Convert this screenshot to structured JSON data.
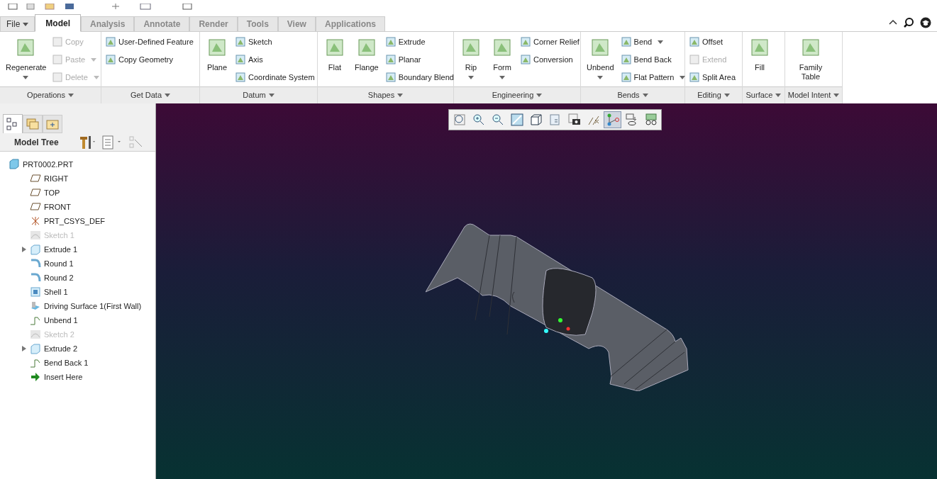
{
  "file_menu": {
    "label": "File"
  },
  "tabs": [
    {
      "label": "Model",
      "selected": true
    },
    {
      "label": "Analysis",
      "selected": false
    },
    {
      "label": "Annotate",
      "selected": false
    },
    {
      "label": "Render",
      "selected": false
    },
    {
      "label": "Tools",
      "selected": false
    },
    {
      "label": "View",
      "selected": false
    },
    {
      "label": "Applications",
      "selected": false
    }
  ],
  "ribbon_groups": [
    {
      "title": "Operations",
      "items": [
        {
          "kind": "large",
          "label": "Regenerate",
          "dropdown": true,
          "disabled": false
        },
        {
          "kind": "small",
          "label": "Copy",
          "dropdown": false,
          "disabled": true
        },
        {
          "kind": "small",
          "label": "Paste",
          "dropdown": true,
          "disabled": true
        },
        {
          "kind": "small",
          "label": "Delete",
          "dropdown": true,
          "disabled": true
        }
      ]
    },
    {
      "title": "Get Data",
      "items": [
        {
          "kind": "small",
          "label": "User-Defined Feature",
          "dropdown": false,
          "disabled": false
        },
        {
          "kind": "small",
          "label": "Copy Geometry",
          "dropdown": false,
          "disabled": false
        }
      ]
    },
    {
      "title": "Datum",
      "items": [
        {
          "kind": "large",
          "label": "Plane",
          "dropdown": false,
          "disabled": false
        },
        {
          "kind": "small",
          "label": "Sketch",
          "dropdown": false,
          "disabled": false
        },
        {
          "kind": "small",
          "label": "Axis",
          "dropdown": false,
          "disabled": false
        },
        {
          "kind": "small",
          "label": "Coordinate System",
          "dropdown": false,
          "disabled": false
        }
      ]
    },
    {
      "title": "Shapes",
      "items": [
        {
          "kind": "large",
          "label": "Flat",
          "dropdown": false,
          "disabled": false
        },
        {
          "kind": "large",
          "label": "Flange",
          "dropdown": false,
          "disabled": false
        },
        {
          "kind": "small",
          "label": "Extrude",
          "dropdown": false,
          "disabled": false
        },
        {
          "kind": "small",
          "label": "Planar",
          "dropdown": false,
          "disabled": false
        },
        {
          "kind": "small",
          "label": "Boundary Blend",
          "dropdown": false,
          "disabled": false
        }
      ]
    },
    {
      "title": "Engineering",
      "items": [
        {
          "kind": "large",
          "label": "Rip",
          "dropdown": true,
          "disabled": false
        },
        {
          "kind": "large",
          "label": "Form",
          "dropdown": true,
          "disabled": false
        },
        {
          "kind": "small",
          "label": "Corner Relief",
          "dropdown": false,
          "disabled": false
        },
        {
          "kind": "small",
          "label": "Conversion",
          "dropdown": false,
          "disabled": false
        }
      ]
    },
    {
      "title": "Bends",
      "items": [
        {
          "kind": "large",
          "label": "Unbend",
          "dropdown": true,
          "disabled": false
        },
        {
          "kind": "small",
          "label": "Bend",
          "dropdown": true,
          "disabled": false
        },
        {
          "kind": "small",
          "label": "Bend Back",
          "dropdown": false,
          "disabled": false
        },
        {
          "kind": "small",
          "label": "Flat Pattern",
          "dropdown": true,
          "disabled": false
        }
      ]
    },
    {
      "title": "Editing",
      "items": [
        {
          "kind": "small",
          "label": "Offset",
          "dropdown": false,
          "disabled": false
        },
        {
          "kind": "small",
          "label": "Extend",
          "dropdown": false,
          "disabled": true
        },
        {
          "kind": "small",
          "label": "Split Area",
          "dropdown": false,
          "disabled": false
        }
      ]
    },
    {
      "title": "Surface",
      "items": [
        {
          "kind": "large",
          "label": "Fill",
          "dropdown": false,
          "disabled": false
        }
      ]
    },
    {
      "title": "Model Intent",
      "items": [
        {
          "kind": "large",
          "label": "Family Table",
          "dropdown": false,
          "disabled": false
        }
      ]
    }
  ],
  "navigator": {
    "tabs": [
      {
        "selected": true
      },
      {
        "selected": false
      },
      {
        "selected": false
      }
    ],
    "title": "Model Tree"
  },
  "tree": [
    {
      "label": "PRT0002.PRT",
      "kind": "part",
      "suppressed": false,
      "children": [
        {
          "label": "RIGHT",
          "kind": "plane",
          "suppressed": false,
          "expandable": false
        },
        {
          "label": "TOP",
          "kind": "plane",
          "suppressed": false,
          "expandable": false
        },
        {
          "label": "FRONT",
          "kind": "plane",
          "suppressed": false,
          "expandable": false
        },
        {
          "label": "PRT_CSYS_DEF",
          "kind": "csys",
          "suppressed": false,
          "expandable": false
        },
        {
          "label": "Sketch 1",
          "kind": "sketch",
          "suppressed": true,
          "expandable": false
        },
        {
          "label": "Extrude 1",
          "kind": "solid",
          "suppressed": false,
          "expandable": true
        },
        {
          "label": "Round 1",
          "kind": "round",
          "suppressed": false,
          "expandable": false
        },
        {
          "label": "Round 2",
          "kind": "round",
          "suppressed": false,
          "expandable": false
        },
        {
          "label": "Shell 1",
          "kind": "shell",
          "suppressed": false,
          "expandable": false
        },
        {
          "label": "Driving Surface 1(First Wall)",
          "kind": "wall",
          "suppressed": false,
          "expandable": false
        },
        {
          "label": "Unbend 1",
          "kind": "bend",
          "suppressed": false,
          "expandable": false
        },
        {
          "label": "Sketch 2",
          "kind": "sketch",
          "suppressed": true,
          "expandable": false
        },
        {
          "label": "Extrude 2",
          "kind": "solid",
          "suppressed": false,
          "expandable": true
        },
        {
          "label": "Bend Back 1",
          "kind": "bend",
          "suppressed": false,
          "expandable": false
        },
        {
          "label": "Insert Here",
          "kind": "insert",
          "suppressed": false,
          "expandable": false
        }
      ]
    }
  ],
  "graphics_toolbar": [
    {
      "selected": false
    },
    {
      "selected": false
    },
    {
      "selected": false
    },
    {
      "selected": false
    },
    {
      "selected": false
    },
    {
      "selected": false
    },
    {
      "selected": false
    },
    {
      "selected": false
    },
    {
      "selected": true
    },
    {
      "selected": false
    },
    {
      "selected": false
    }
  ]
}
